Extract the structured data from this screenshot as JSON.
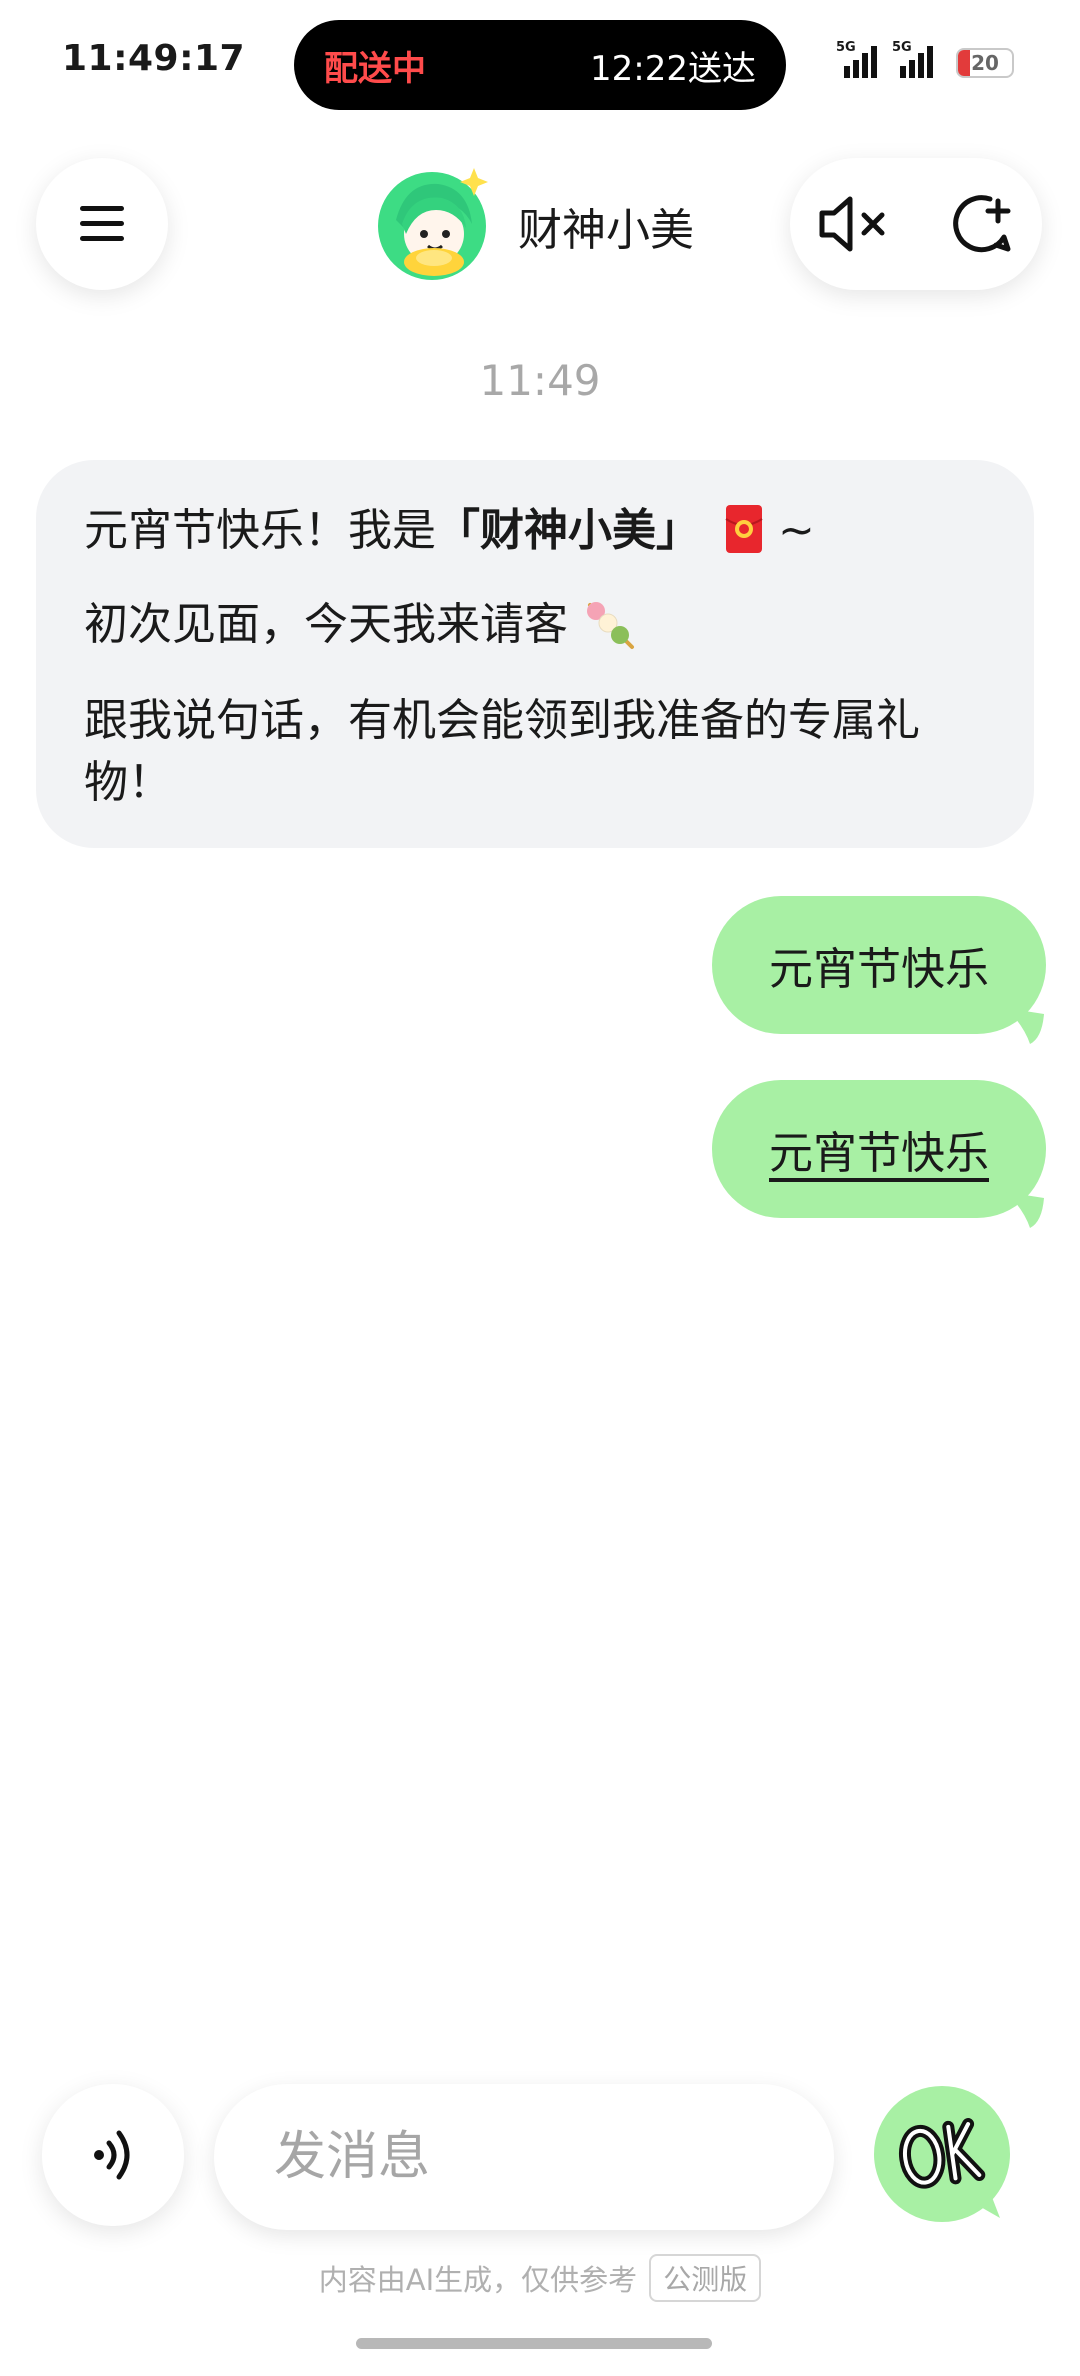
{
  "status_bar": {
    "time": "11:49:17",
    "delivery_status": "配送中",
    "delivery_eta": "12:22送达",
    "signal1_label": "5G",
    "signal2_label": "5G",
    "battery": "20"
  },
  "header": {
    "title": "财神小美",
    "menu_icon": "hamburger-icon",
    "mute_icon": "speaker-muted-icon",
    "new_chat_icon": "new-chat-icon"
  },
  "chat": {
    "timestamp": "11:49",
    "bot_message": {
      "line1_prefix": "元宵节快乐！我是",
      "line1_name": "「财神小美」",
      "line1_suffix": " ~",
      "line2": "初次见面，今天我来请客",
      "line3": "跟我说句话，有机会能领到我准备的专属礼物！"
    },
    "user_messages": [
      "元宵节快乐",
      "元宵节快乐"
    ]
  },
  "input": {
    "placeholder": "发消息",
    "voice_icon": "voice-input-icon",
    "send_icon": "ok-send-icon"
  },
  "footer": {
    "disclaimer": "内容由AI生成，仅供参考",
    "badge": "公测版"
  },
  "colors": {
    "user_bubble": "#a8f0a4",
    "bot_bubble": "#f2f3f5",
    "delivery_red": "#ff4b4b",
    "battery_low": "#e23b3b"
  }
}
